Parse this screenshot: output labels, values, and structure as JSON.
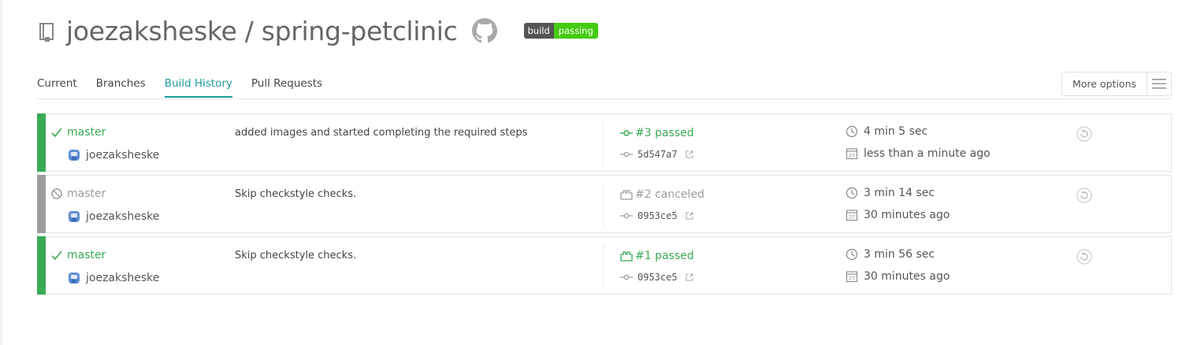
{
  "repo": {
    "title": "joezaksheske / spring-petclinic"
  },
  "badge": {
    "label": "build",
    "status": "passing"
  },
  "tabs": [
    {
      "label": "Current"
    },
    {
      "label": "Branches"
    },
    {
      "label": "Build History"
    },
    {
      "label": "Pull Requests"
    }
  ],
  "more_options": {
    "label": "More options"
  },
  "builds": [
    {
      "state": "passed",
      "branch": "master",
      "author": "joezaksheske",
      "message": "added images and started completing the required steps",
      "build": "#3 passed",
      "commit": "5d547a7",
      "duration": "4 min 5 sec",
      "finished": "less than a minute ago"
    },
    {
      "state": "canceled",
      "branch": "master",
      "author": "joezaksheske",
      "message": "Skip checkstyle checks.",
      "build": "#2 canceled",
      "commit": "0953ce5",
      "duration": "3 min 14 sec",
      "finished": "30 minutes ago"
    },
    {
      "state": "passed",
      "branch": "master",
      "author": "joezaksheske",
      "message": "Skip checkstyle checks.",
      "build": "#1 passed",
      "commit": "0953ce5",
      "duration": "3 min 56 sec",
      "finished": "30 minutes ago"
    }
  ],
  "colors": {
    "passed": "#39aa56",
    "canceled": "#9d9d9d",
    "accent": "#1d9ca0",
    "badge_ok": "#44cc11"
  },
  "icons": {
    "repo": "repo-book-icon",
    "github": "github-octocat-icon",
    "menu": "hamburger-menu-icon",
    "status_passed": "checkmark-icon",
    "status_canceled": "cancel-circle-icon",
    "author": "avatar-icon",
    "build": "build-icon",
    "commit": "commit-icon",
    "external": "external-link-icon",
    "duration": "clock-icon",
    "finished": "calendar-icon",
    "restart": "restart-icon"
  }
}
